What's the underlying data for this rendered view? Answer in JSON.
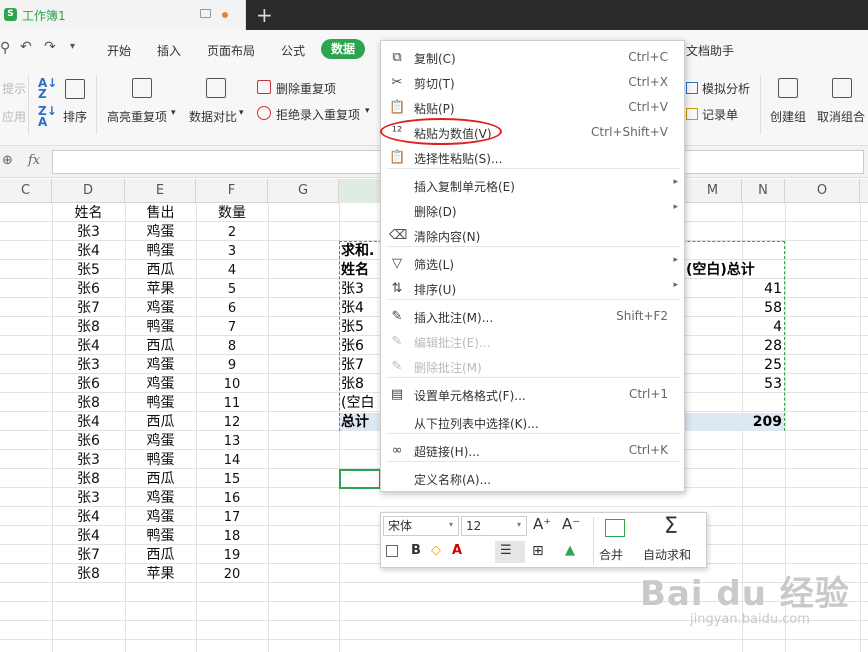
{
  "window": {
    "tab_title": "工作簿1",
    "logo_letter": "S",
    "new_tab": "+"
  },
  "menu": {
    "items": [
      "开始",
      "插入",
      "页面布局",
      "公式",
      "数据"
    ],
    "active": "数据",
    "right_item": "文档助手",
    "left_partial": "Q"
  },
  "toolbar": {
    "left_partial": [
      "提示",
      "应用"
    ],
    "sort_label": "排序",
    "highlight_dup": "高亮重复项",
    "data_compare": "数据对比",
    "delete_dup": "删除重复项",
    "reject_dup": "拒绝录入重复项",
    "what_if": "模拟分析",
    "record_form": "记录单",
    "create_group": "创建组",
    "ungroup": "取消组合",
    "dropdown": "▾"
  },
  "formula_bar": {
    "fx": "fx",
    "value": ""
  },
  "columns": [
    "C",
    "D",
    "E",
    "F",
    "G",
    "",
    "",
    "",
    "",
    "",
    "",
    "",
    "M",
    "N",
    "O"
  ],
  "table": {
    "headers": [
      "姓名",
      "售出",
      "数量"
    ],
    "rows": [
      [
        "张3",
        "鸡蛋",
        "2"
      ],
      [
        "张4",
        "鸭蛋",
        "3"
      ],
      [
        "张5",
        "西瓜",
        "4"
      ],
      [
        "张6",
        "苹果",
        "5"
      ],
      [
        "张7",
        "鸡蛋",
        "6"
      ],
      [
        "张8",
        "鸭蛋",
        "7"
      ],
      [
        "张4",
        "西瓜",
        "8"
      ],
      [
        "张3",
        "鸡蛋",
        "9"
      ],
      [
        "张6",
        "鸡蛋",
        "10"
      ],
      [
        "张8",
        "鸭蛋",
        "11"
      ],
      [
        "张4",
        "西瓜",
        "12"
      ],
      [
        "张6",
        "鸡蛋",
        "13"
      ],
      [
        "张3",
        "鸭蛋",
        "14"
      ],
      [
        "张8",
        "西瓜",
        "15"
      ],
      [
        "张3",
        "鸡蛋",
        "16"
      ],
      [
        "张4",
        "鸡蛋",
        "17"
      ],
      [
        "张4",
        "鸭蛋",
        "18"
      ],
      [
        "张7",
        "西瓜",
        "19"
      ],
      [
        "张8",
        "苹果",
        "20"
      ]
    ]
  },
  "pivot": {
    "title": "求和.",
    "header": "姓名",
    "rows": [
      "张3",
      "张4",
      "张5",
      "张6",
      "张7",
      "张8",
      "(空白"
    ],
    "total_label": "总计",
    "right_header": "(空白)总计",
    "values": [
      "41",
      "58",
      "4",
      "28",
      "25",
      "53"
    ],
    "grand_total": "209"
  },
  "context_menu": {
    "items": [
      {
        "icon": "copy-icon",
        "glyph": "⧉",
        "label": "复制(C)",
        "shortcut": "Ctrl+C"
      },
      {
        "icon": "cut-icon",
        "glyph": "✂",
        "label": "剪切(T)",
        "shortcut": "Ctrl+X"
      },
      {
        "icon": "paste-icon",
        "glyph": "📋",
        "label": "粘贴(P)",
        "shortcut": "Ctrl+V"
      },
      {
        "icon": "paste-values-icon",
        "glyph": "¹²",
        "label": "粘贴为数值(V)",
        "shortcut": "Ctrl+Shift+V"
      },
      {
        "icon": "paste-special-icon",
        "glyph": "📋",
        "label": "选择性粘贴(S)...",
        "shortcut": ""
      },
      {
        "icon": "",
        "glyph": "",
        "label": "插入复制单元格(E)",
        "shortcut": "",
        "arrow": "▸"
      },
      {
        "icon": "",
        "glyph": "",
        "label": "删除(D)",
        "shortcut": "",
        "arrow": "▸"
      },
      {
        "icon": "clear-icon",
        "glyph": "⌫",
        "label": "清除内容(N)",
        "shortcut": ""
      },
      {
        "icon": "filter-icon",
        "glyph": "▽",
        "label": "筛选(L)",
        "shortcut": "",
        "arrow": "▸"
      },
      {
        "icon": "sort-icon",
        "glyph": "⇅",
        "label": "排序(U)",
        "shortcut": "",
        "arrow": "▸"
      },
      {
        "icon": "comment-icon",
        "glyph": "✎",
        "label": "插入批注(M)...",
        "shortcut": "Shift+F2"
      },
      {
        "icon": "edit-comment-icon",
        "glyph": "✎",
        "label": "编辑批注(E)...",
        "shortcut": "",
        "disabled": true
      },
      {
        "icon": "delete-comment-icon",
        "glyph": "✎",
        "label": "删除批注(M)",
        "shortcut": "",
        "disabled": true
      },
      {
        "icon": "format-cells-icon",
        "glyph": "▤",
        "label": "设置单元格格式(F)...",
        "shortcut": "Ctrl+1"
      },
      {
        "icon": "",
        "glyph": "",
        "label": "从下拉列表中选择(K)...",
        "shortcut": ""
      },
      {
        "icon": "link-icon",
        "glyph": "∞",
        "label": "超链接(H)...",
        "shortcut": "Ctrl+K"
      },
      {
        "icon": "",
        "glyph": "",
        "label": "定义名称(A)...",
        "shortcut": ""
      }
    ]
  },
  "float_toolbar": {
    "font": "宋体",
    "size": "12",
    "increase": "A⁺",
    "decrease": "A⁻",
    "bold": "B",
    "merge": "合并",
    "autosum": "自动求和",
    "sigma": "Σ"
  },
  "watermark": {
    "main": "Bai du 经验",
    "sub": "jingyan.baidu.com"
  }
}
